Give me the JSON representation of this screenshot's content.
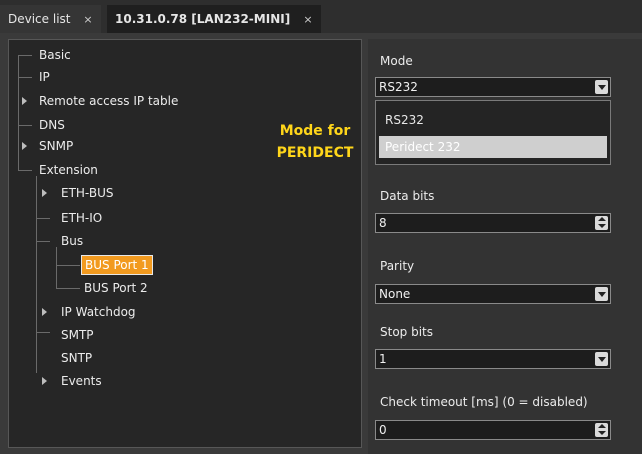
{
  "tabs": [
    {
      "label": "Device list",
      "close": "×"
    },
    {
      "label": "10.31.0.78 [LAN232-MINI]",
      "close": "×"
    }
  ],
  "tree": {
    "basic": "Basic",
    "ip": "IP",
    "remote_access": "Remote access IP table",
    "dns": "DNS",
    "snmp": "SNMP",
    "extension": "Extension",
    "eth_bus": "ETH-BUS",
    "eth_io": "ETH-IO",
    "bus": "Bus",
    "bus_port_1": "BUS Port 1",
    "bus_port_2": "BUS Port 2",
    "ip_watchdog": "IP Watchdog",
    "smtp": "SMTP",
    "sntp": "SNTP",
    "events": "Events"
  },
  "annotation": {
    "line1": "Mode for",
    "line2": "PERIDECT"
  },
  "form": {
    "mode": {
      "label": "Mode",
      "value": "RS232",
      "options": [
        "RS232",
        "Peridect 232"
      ],
      "highlighted": "Peridect 232"
    },
    "data_bits": {
      "label": "Data bits",
      "value": "8"
    },
    "parity": {
      "label": "Parity",
      "value": "None"
    },
    "stop_bits": {
      "label": "Stop bits",
      "value": "1"
    },
    "check_timeout": {
      "label": "Check timeout [ms] (0 = disabled)",
      "value": "0"
    }
  },
  "colors": {
    "selection": "#f29a1f",
    "annotation": "#ffd61a"
  }
}
